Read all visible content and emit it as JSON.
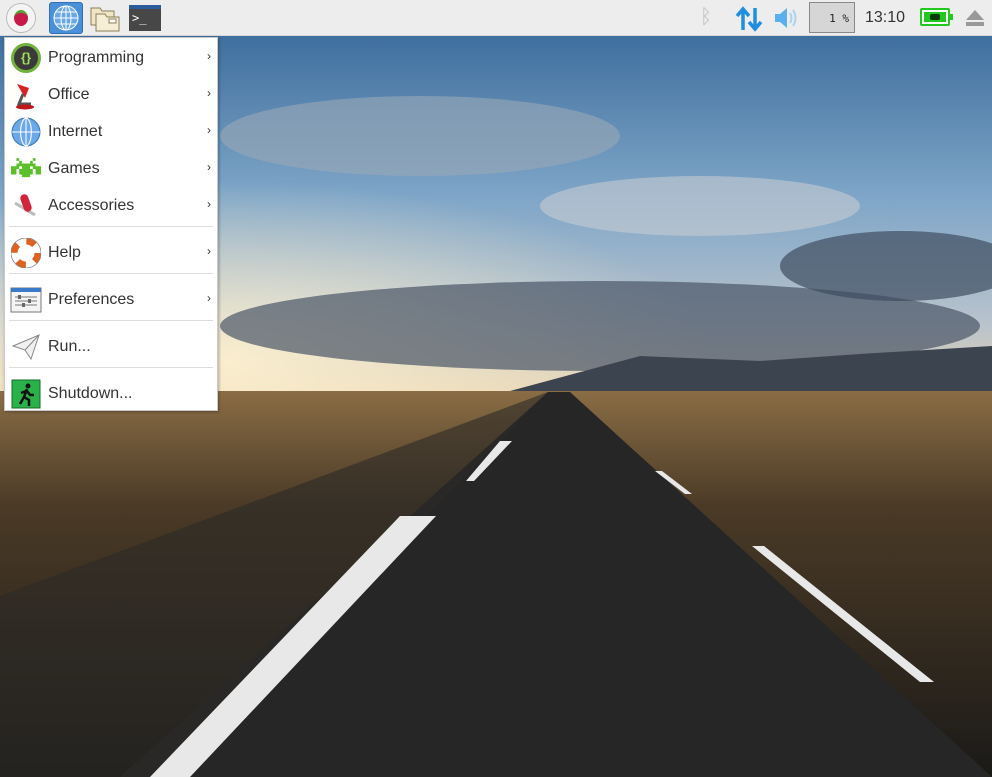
{
  "taskbar": {
    "launchers": [
      {
        "name": "menu",
        "icon": "raspberry-icon"
      },
      {
        "name": "web-browser",
        "icon": "globe-icon"
      },
      {
        "name": "file-manager",
        "icon": "folder-icon"
      },
      {
        "name": "terminal",
        "icon": "terminal-icon",
        "glyph": ">_"
      }
    ],
    "tray": {
      "bluetooth_icon": "bluetooth-icon",
      "network_icon": "network-arrows-icon",
      "volume_icon": "speaker-icon",
      "cpu_usage": "1 %",
      "clock": "13:10",
      "battery_icon": "battery-charging-icon",
      "eject_icon": "eject-icon"
    }
  },
  "menu": {
    "items": [
      {
        "label": "Programming",
        "icon": "programming-icon",
        "submenu": true
      },
      {
        "label": "Office",
        "icon": "office-lamp-icon",
        "submenu": true
      },
      {
        "label": "Internet",
        "icon": "globe-icon",
        "submenu": true
      },
      {
        "label": "Games",
        "icon": "space-invader-icon",
        "submenu": true
      },
      {
        "label": "Accessories",
        "icon": "swiss-knife-icon",
        "submenu": true
      },
      {
        "label": "Help",
        "icon": "lifebuoy-icon",
        "submenu": true
      },
      {
        "label": "Preferences",
        "icon": "preferences-icon",
        "submenu": true
      },
      {
        "label": "Run...",
        "icon": "paper-plane-icon",
        "submenu": false
      },
      {
        "label": "Shutdown...",
        "icon": "exit-icon",
        "submenu": false
      }
    ],
    "arrow": "›"
  },
  "colors": {
    "accent": "#4a90d9",
    "battery": "#22c81e",
    "network": "#1e8ee0"
  }
}
